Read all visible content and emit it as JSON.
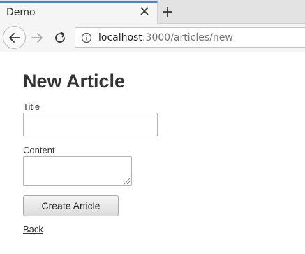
{
  "browser": {
    "tab": {
      "title": "Demo",
      "close_icon": "close-icon"
    },
    "new_tab_icon": "plus-icon",
    "nav": {
      "back_icon": "arrow-left-icon",
      "forward_icon": "arrow-right-icon",
      "reload_icon": "reload-icon"
    },
    "url": {
      "host": "localhost",
      "path": ":3000/articles/new",
      "info_icon": "info-icon"
    },
    "colors": {
      "tab_accent": "#3b8be0"
    }
  },
  "page": {
    "heading": "New Article",
    "form": {
      "title_label": "Title",
      "title_value": "",
      "content_label": "Content",
      "content_value": "",
      "submit_label": "Create Article"
    },
    "back_link": "Back"
  }
}
